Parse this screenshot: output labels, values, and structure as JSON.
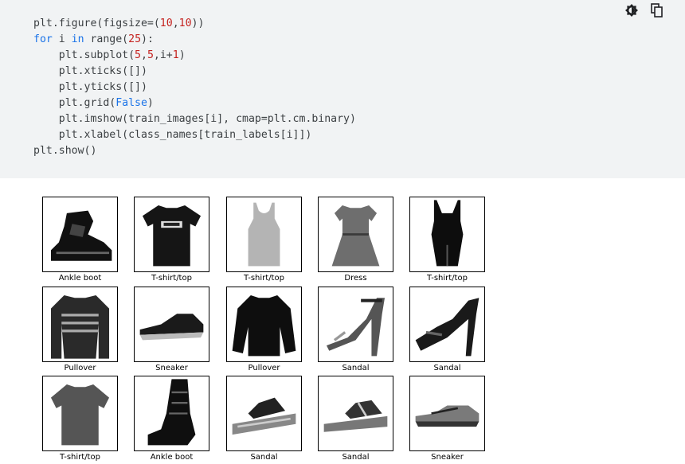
{
  "toolbar": {
    "items": [
      {
        "icon": "brightness-icon"
      },
      {
        "icon": "copy-icon"
      }
    ]
  },
  "code": {
    "line1": {
      "a": "plt.figure(figsize=(",
      "n1": "10",
      "comma": ",",
      "n2": "10",
      "b": "))"
    },
    "line2": {
      "kw1": "for",
      "a": " i ",
      "kw2": "in",
      "b": " range(",
      "n": "25",
      "c": "):"
    },
    "line3": {
      "a": "    plt.subplot(",
      "n1": "5",
      "c1": ",",
      "n2": "5",
      "c2": ",i+",
      "n3": "1",
      "b": ")"
    },
    "line4": "    plt.xticks([])",
    "line5": "    plt.yticks([])",
    "line6": {
      "a": "    plt.grid(",
      "const": "False",
      "b": ")"
    },
    "line7": "    plt.imshow(train_images[i], cmap=plt.cm.binary)",
    "line8": "    plt.xlabel(class_names[train_labels[i]])",
    "line9": "plt.show()"
  },
  "output": {
    "tiles": [
      {
        "label": "Ankle boot",
        "icon": "ankle-boot-image"
      },
      {
        "label": "T-shirt/top",
        "icon": "tshirt-image"
      },
      {
        "label": "T-shirt/top",
        "icon": "tank-top-image"
      },
      {
        "label": "Dress",
        "icon": "dress-image"
      },
      {
        "label": "T-shirt/top",
        "icon": "dark-tank-image"
      },
      {
        "label": "Pullover",
        "icon": "striped-pullover-image"
      },
      {
        "label": "Sneaker",
        "icon": "sneaker-image"
      },
      {
        "label": "Pullover",
        "icon": "pullover-image"
      },
      {
        "label": "Sandal",
        "icon": "sandal-heel-image"
      },
      {
        "label": "Sandal",
        "icon": "sandal-heel-dark-image"
      },
      {
        "label": "T-shirt/top",
        "icon": "tshirt-grey-image"
      },
      {
        "label": "Ankle boot",
        "icon": "heeled-boot-image"
      },
      {
        "label": "Sandal",
        "icon": "flat-sandal-image"
      },
      {
        "label": "Sandal",
        "icon": "flat-sandal-2-image"
      },
      {
        "label": "Sneaker",
        "icon": "sneaker-2-image"
      }
    ]
  }
}
